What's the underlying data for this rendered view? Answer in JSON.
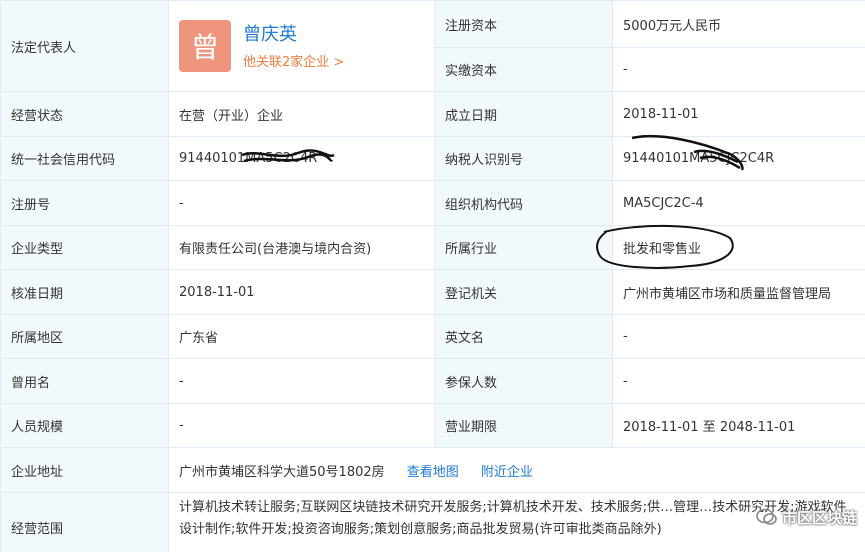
{
  "legal_rep": {
    "label": "法定代表人",
    "avatar_char": "曾",
    "name": "曾庆英",
    "related": "他关联2家企业 >"
  },
  "registered_capital": {
    "label": "注册资本",
    "value": "5000万元人民币"
  },
  "paid_capital": {
    "label": "实缴资本",
    "value": "-"
  },
  "rows": [
    {
      "l1": "经营状态",
      "v1": "在营（开业）企业",
      "l2": "成立日期",
      "v2": "2018-11-01"
    },
    {
      "l1": "统一社会信用代码",
      "v1": "91440101MA5C2C4R",
      "l2": "纳税人识别号",
      "v2": "91440101MA5CJC2C4R"
    },
    {
      "l1": "注册号",
      "v1": "-",
      "l2": "组织机构代码",
      "v2": "MA5CJC2C-4"
    },
    {
      "l1": "企业类型",
      "v1": "有限责任公司(台港澳与境内合资)",
      "l2": "所属行业",
      "v2": "批发和零售业"
    },
    {
      "l1": "核准日期",
      "v1": "2018-11-01",
      "l2": "登记机关",
      "v2": "广州市黄埔区市场和质量监督管理局"
    },
    {
      "l1": "所属地区",
      "v1": "广东省",
      "l2": "英文名",
      "v2": "-"
    },
    {
      "l1": "曾用名",
      "v1": "-",
      "l2": "参保人数",
      "v2": "-"
    },
    {
      "l1": "人员规模",
      "v1": "-",
      "l2": "营业期限",
      "v2": "2018-11-01 至 2048-11-01"
    }
  ],
  "address": {
    "label": "企业地址",
    "value": "广州市黄埔区科学大道50号1802房",
    "map_link": "查看地图",
    "nearby_link": "附近企业"
  },
  "scope": {
    "label": "经营范围",
    "value": "计算机技术转让服务;互联网区块链技术研究开发服务;计算机技术开发、技术服务;供…管理…技术研究开发;游戏软件设计制作;软件开发;投资咨询服务;策划创意服务;商品批发贸易(许可审批类商品除外)"
  },
  "watermark": {
    "text": "市区区块链"
  },
  "colors": {
    "label_bg": "#f2f9fc",
    "border": "#e4eaf2",
    "link": "#1e7bd6",
    "orange": "#f07d3c",
    "avatar": "#f0957d"
  }
}
